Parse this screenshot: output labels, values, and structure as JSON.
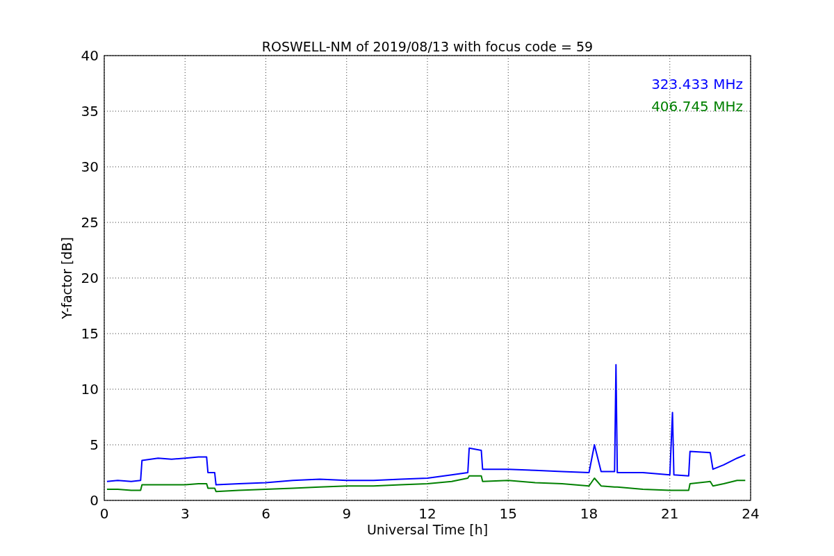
{
  "figure": {
    "chart_data": {
      "type": "line",
      "title": "ROSWELL-NM of 2019/08/13 with focus code = 59",
      "xlabel": "Universal Time [h]",
      "ylabel": "Y-factor [dB]",
      "grid": true,
      "xlim": [
        0,
        24
      ],
      "ylim": [
        0,
        40
      ],
      "xticks": [
        0,
        3,
        6,
        9,
        12,
        15,
        18,
        21,
        24
      ],
      "yticks": [
        0,
        5,
        10,
        15,
        20,
        25,
        30,
        35,
        40
      ],
      "x": [
        0.1,
        0.5,
        1,
        1.35,
        1.4,
        2,
        2.5,
        3,
        3.5,
        3.8,
        3.85,
        4.1,
        4.15,
        5,
        6,
        7,
        8,
        9,
        10,
        11,
        12,
        12.9,
        13.5,
        13.55,
        14,
        14.05,
        15,
        16,
        17,
        18,
        18.2,
        18.45,
        18.95,
        19,
        19.05,
        20,
        21,
        21.1,
        21.15,
        21.7,
        21.75,
        22.5,
        22.6,
        23,
        23.5,
        23.8
      ],
      "series": [
        {
          "name": "323.433 MHz",
          "color": "#0000ff",
          "values": [
            1.7,
            1.8,
            1.7,
            1.8,
            3.6,
            3.8,
            3.7,
            3.8,
            3.9,
            3.9,
            2.5,
            2.5,
            1.4,
            1.5,
            1.6,
            1.8,
            1.9,
            1.8,
            1.8,
            1.9,
            2.0,
            2.3,
            2.5,
            4.7,
            4.5,
            2.8,
            2.8,
            2.7,
            2.6,
            2.5,
            5.0,
            2.6,
            2.6,
            12.2,
            2.5,
            2.5,
            2.3,
            7.9,
            2.3,
            2.2,
            4.4,
            4.3,
            2.8,
            3.2,
            3.8,
            4.1
          ]
        },
        {
          "name": "406.745 MHz",
          "color": "#008000",
          "values": [
            1.0,
            1.0,
            0.9,
            0.9,
            1.4,
            1.4,
            1.4,
            1.4,
            1.5,
            1.5,
            1.1,
            1.1,
            0.8,
            0.9,
            1.0,
            1.1,
            1.2,
            1.3,
            1.3,
            1.4,
            1.5,
            1.7,
            2.0,
            2.2,
            2.2,
            1.7,
            1.8,
            1.6,
            1.5,
            1.3,
            2.0,
            1.3,
            1.2,
            1.2,
            1.2,
            1.0,
            0.9,
            0.9,
            0.9,
            0.9,
            1.5,
            1.7,
            1.3,
            1.5,
            1.8,
            1.8
          ]
        }
      ]
    }
  }
}
